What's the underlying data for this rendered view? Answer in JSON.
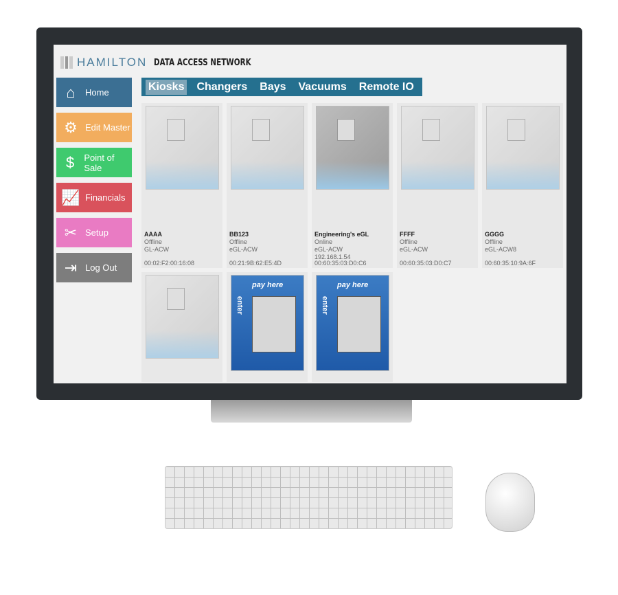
{
  "header": {
    "brand": "HAMILTON",
    "subtitle": "DATA ACCESS NETWORK"
  },
  "sidebar": {
    "items": [
      {
        "label": "Home",
        "icon": "home-icon",
        "color": "#3b6f93"
      },
      {
        "label": "Edit Master",
        "icon": "gears-icon",
        "color": "#f2ad5e"
      },
      {
        "label": "Point of Sale",
        "icon": "dollar-monitor-icon",
        "color": "#3fca6e"
      },
      {
        "label": "Financials",
        "icon": "chart-icon",
        "color": "#d9525c"
      },
      {
        "label": "Setup",
        "icon": "tools-icon",
        "color": "#e97bc3"
      },
      {
        "label": "Log Out",
        "icon": "exit-door-icon",
        "color": "#7d7d7d"
      }
    ]
  },
  "tabs": [
    {
      "label": "Kiosks",
      "active": true
    },
    {
      "label": "Changers"
    },
    {
      "label": "Bays"
    },
    {
      "label": "Vacuums"
    },
    {
      "label": "Remote IO"
    }
  ],
  "devices": [
    {
      "name": "AAAA",
      "status": "Offline",
      "model": "GL-ACW",
      "ip": "",
      "mac": "00:02:F2:00:16:08"
    },
    {
      "name": "BB123",
      "status": "Offline",
      "model": "eGL-ACW",
      "ip": "",
      "mac": "00:21:9B:62:E5:4D"
    },
    {
      "name": "Engineering's eGL",
      "status": "Online",
      "model": "eGL-ACW",
      "ip": "192.168.1.54",
      "mac": "00:60:35:03:D0:C6"
    },
    {
      "name": "FFFF",
      "status": "Offline",
      "model": "eGL-ACW",
      "ip": "",
      "mac": "00:60:35:03:D0:C7"
    },
    {
      "name": "GGGG",
      "status": "Offline",
      "model": "eGL-ACW8",
      "ip": "",
      "mac": "00:60:35:10:9A:6F"
    }
  ],
  "pay_kiosk": {
    "top_text": "pay here",
    "side_text": "enter"
  }
}
